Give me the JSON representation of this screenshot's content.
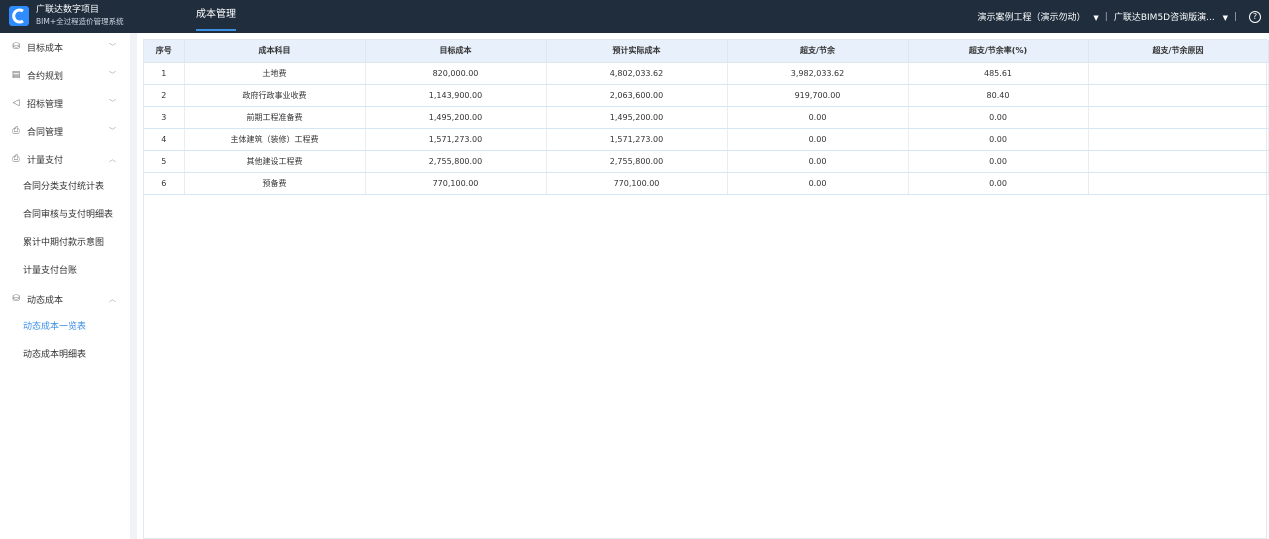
{
  "header": {
    "app_title": "广联达数字项目",
    "app_subtitle": "BIM+全过程造价管理系统",
    "active_tab": "成本管理",
    "project_selector": "演示案例工程（演示勿动）",
    "company_selector": "广联达BIM5D咨询版演...",
    "help_icon": "question-circle-icon"
  },
  "sidebar": {
    "groups": [
      {
        "label": "目标成本",
        "icon": "database-icon",
        "expanded": false
      },
      {
        "label": "合约规划",
        "icon": "document-icon",
        "expanded": false
      },
      {
        "label": "招标管理",
        "icon": "send-icon",
        "expanded": false
      },
      {
        "label": "合同管理",
        "icon": "printer-icon",
        "expanded": false
      },
      {
        "label": "计量支付",
        "icon": "printer-icon",
        "expanded": true
      },
      {
        "label": "动态成本",
        "icon": "database-icon",
        "expanded": true
      }
    ],
    "payment_items": [
      "合同分类支付统计表",
      "合同审核与支付明细表",
      "累计中期付款示意图",
      "计量支付台账"
    ],
    "dynamic_items": [
      "动态成本一览表",
      "动态成本明细表"
    ],
    "active_item": "动态成本一览表"
  },
  "table": {
    "headers": [
      "序号",
      "成本科目",
      "目标成本",
      "预计实际成本",
      "超支/节余",
      "超支/节余率(%)",
      "超支/节余原因"
    ],
    "rows": [
      [
        "1",
        "土地费",
        "820,000.00",
        "4,802,033.62",
        "3,982,033.62",
        "485.61",
        ""
      ],
      [
        "2",
        "政府行政事业收费",
        "1,143,900.00",
        "2,063,600.00",
        "919,700.00",
        "80.40",
        ""
      ],
      [
        "3",
        "前期工程准备费",
        "1,495,200.00",
        "1,495,200.00",
        "0.00",
        "0.00",
        ""
      ],
      [
        "4",
        "主体建筑（装修）工程费",
        "1,571,273.00",
        "1,571,273.00",
        "0.00",
        "0.00",
        ""
      ],
      [
        "5",
        "其他建设工程费",
        "2,755,800.00",
        "2,755,800.00",
        "0.00",
        "0.00",
        ""
      ],
      [
        "6",
        "预备费",
        "770,100.00",
        "770,100.00",
        "0.00",
        "0.00",
        ""
      ]
    ]
  },
  "colors": {
    "topbar": "#1f2d3d",
    "accent": "#3a8ee6",
    "header_row": "#e8f1fb"
  }
}
